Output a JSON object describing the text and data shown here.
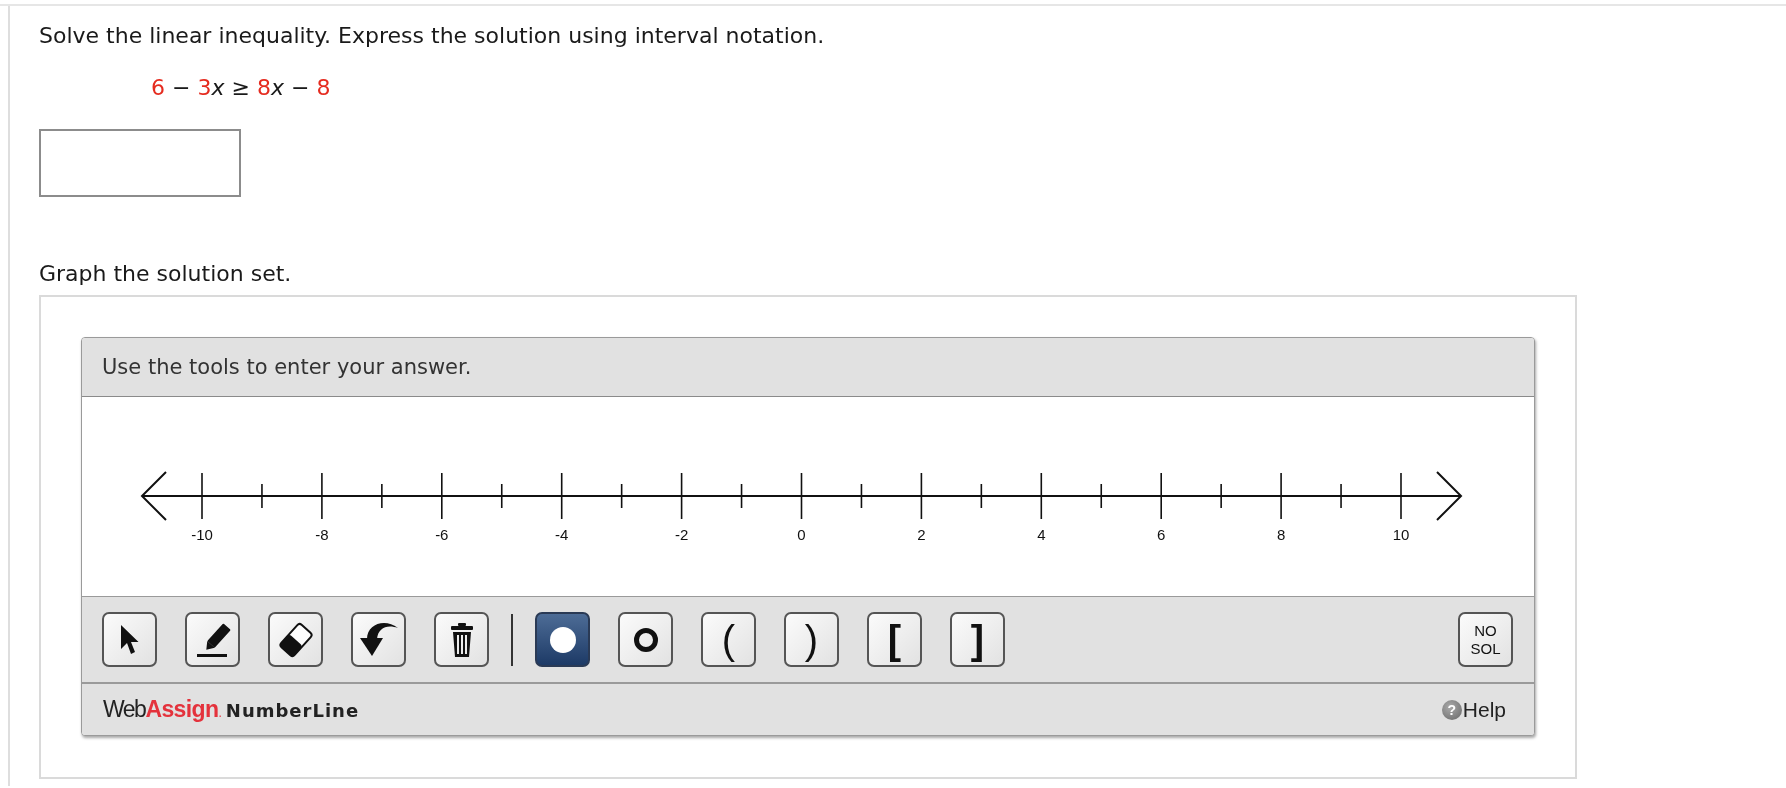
{
  "question": {
    "prompt": "Solve the linear inequality. Express the solution using interval notation.",
    "inequality": [
      {
        "text": "6",
        "kind": "number"
      },
      {
        "text": "−",
        "kind": "operator"
      },
      {
        "text": "3",
        "kind": "number"
      },
      {
        "text": "x",
        "kind": "variable"
      },
      {
        "text": "≥",
        "kind": "operator"
      },
      {
        "text": "8",
        "kind": "number"
      },
      {
        "text": "x",
        "kind": "variable"
      },
      {
        "text": "−",
        "kind": "operator"
      },
      {
        "text": "8",
        "kind": "number"
      }
    ]
  },
  "graph_prompt": "Graph the solution set.",
  "number_line_tool": {
    "instructions": "Use the tools to enter your answer.",
    "number_line": {
      "labels": [
        "-10",
        "-8",
        "-6",
        "-4",
        "-2",
        "0",
        "2",
        "4",
        "6",
        "8",
        "10"
      ]
    },
    "toolbar": {
      "edit_tools": [
        {
          "kind": "select",
          "selected": false
        },
        {
          "kind": "pencil",
          "selected": false
        },
        {
          "kind": "eraser",
          "selected": false
        },
        {
          "kind": "undo",
          "selected": false
        },
        {
          "kind": "trash",
          "selected": false
        }
      ],
      "point_tools": [
        {
          "kind": "closed-dot",
          "selected": true
        },
        {
          "kind": "open-dot",
          "selected": false
        },
        {
          "kind": "left-paren",
          "label": "(",
          "selected": false
        },
        {
          "kind": "right-paren",
          "label": ")",
          "selected": false
        },
        {
          "kind": "left-bracket",
          "label": "[",
          "selected": false
        },
        {
          "kind": "right-bracket",
          "label": "]",
          "selected": false
        }
      ],
      "no_solution": {
        "label": "NO SOL",
        "selected": false
      }
    },
    "footer": {
      "logo": [
        {
          "text": "Web",
          "kind": "plain"
        },
        {
          "text": "Assign",
          "kind": "accent"
        },
        {
          "text": ".",
          "kind": "mark"
        }
      ],
      "product": "NumberLine",
      "help": {
        "icon": "?",
        "label": "Help"
      }
    }
  }
}
